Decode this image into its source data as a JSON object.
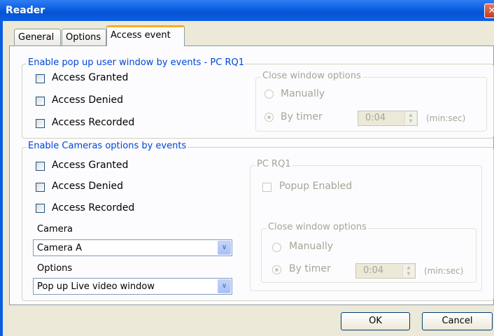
{
  "window": {
    "title": "Reader",
    "close_glyph": "✕"
  },
  "tabs": [
    {
      "label": "General"
    },
    {
      "label": "Options"
    },
    {
      "label": "Access event",
      "active": true
    }
  ],
  "popup_group": {
    "legend": "Enable pop up user window by events - PC RQ1",
    "checkboxes": [
      {
        "label": "Access Granted",
        "checked": false
      },
      {
        "label": "Access Denied",
        "checked": false
      },
      {
        "label": "Access Recorded",
        "checked": false
      }
    ],
    "close_options": {
      "legend": "Close window options",
      "manually_label": "Manually",
      "by_timer_label": "By timer",
      "timer_value": "0:04",
      "unit_label": "(min:sec)",
      "selected": "By timer"
    }
  },
  "cameras_group": {
    "legend": "Enable Cameras options by events",
    "checkboxes": [
      {
        "label": "Access Granted",
        "checked": false
      },
      {
        "label": "Access Denied",
        "checked": false
      },
      {
        "label": "Access Recorded",
        "checked": false
      }
    ],
    "camera_label": "Camera",
    "camera_value": "Camera A",
    "options_label": "Options",
    "options_value": "Pop up Live video window",
    "pc_group": {
      "legend": "PC RQ1",
      "popup_enabled_label": "Popup Enabled",
      "close_options": {
        "legend": "Close window options",
        "manually_label": "Manually",
        "by_timer_label": "By timer",
        "timer_value": "0:04",
        "unit_label": "(min:sec)",
        "selected": "By timer"
      }
    }
  },
  "buttons": {
    "ok": "OK",
    "cancel": "Cancel"
  },
  "icons": {
    "dropdown": "chevron-down-icon",
    "spin_up": "▲",
    "spin_down": "▼"
  },
  "colors": {
    "title_bar": "#0a5ee0",
    "group_legend": "#0046d5",
    "disabled_text": "#a5a597",
    "tab_highlight": "#f2b02b"
  }
}
